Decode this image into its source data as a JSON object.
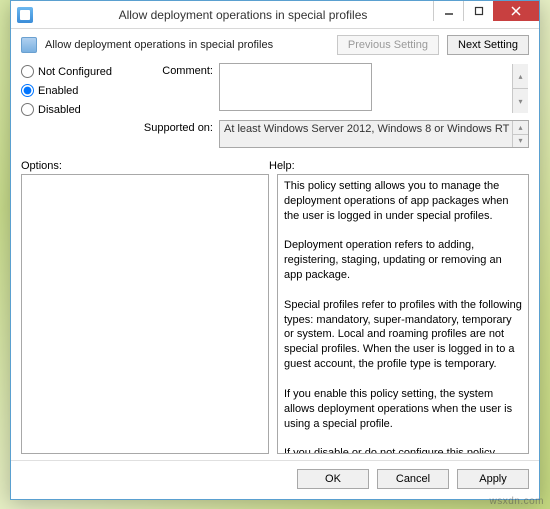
{
  "window": {
    "title": "Allow deployment operations in special profiles"
  },
  "header": {
    "policy_title": "Allow deployment operations in special profiles",
    "previous_setting": "Previous Setting",
    "next_setting": "Next Setting"
  },
  "state": {
    "options": [
      {
        "label": "Not Configured",
        "checked": false
      },
      {
        "label": "Enabled",
        "checked": true
      },
      {
        "label": "Disabled",
        "checked": false
      }
    ],
    "comment_label": "Comment:",
    "comment_value": "",
    "supported_label": "Supported on:",
    "supported_value": "At least Windows Server 2012, Windows 8 or Windows RT"
  },
  "sections": {
    "options_label": "Options:",
    "help_label": "Help:",
    "help_text": "This policy setting allows you to manage the deployment operations of app packages when the user is logged in under special profiles.\n\nDeployment operation refers to adding, registering, staging, updating or removing an app package.\n\nSpecial profiles refer to profiles with the following types: mandatory, super-mandatory, temporary or system. Local and roaming profiles are not special profiles. When the user is logged in to a guest account, the profile type is temporary.\n\nIf you enable this policy setting, the system allows deployment operations when the user is using a special profile.\n\nIf you disable or do not configure this policy setting, the system blocks deployment operations when the user is using a special profile."
  },
  "buttons": {
    "ok": "OK",
    "cancel": "Cancel",
    "apply": "Apply"
  },
  "watermark": "wsxdn.com"
}
